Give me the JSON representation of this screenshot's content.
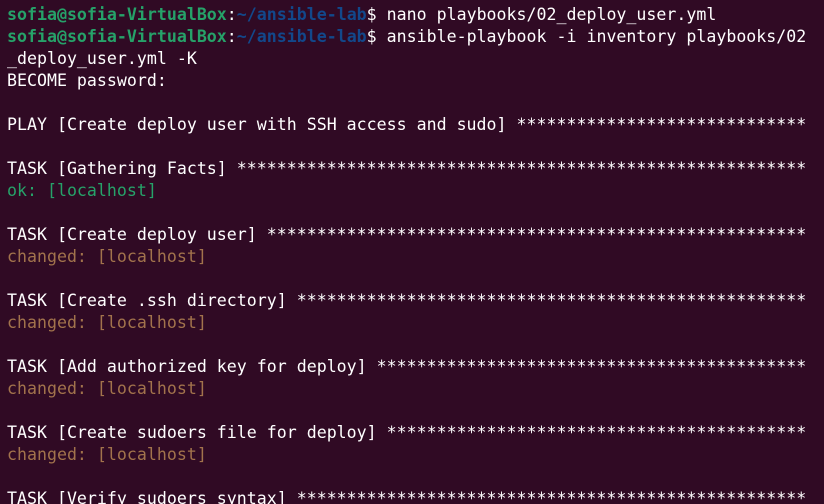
{
  "colors": {
    "background": "#300a24",
    "text": "#ffffff",
    "prompt_user": "#26a269",
    "prompt_path": "#12488b",
    "ok": "#26a269",
    "changed": "#a2734c"
  },
  "prompt": {
    "user_host": "sofia@sofia-VirtualBox",
    "colon": ":",
    "path": "~/ansible-lab",
    "dollar": "$ "
  },
  "commands": [
    "nano playbooks/02_deploy_user.yml",
    "ansible-playbook -i inventory playbooks/02"
  ],
  "command_wrap": "_deploy_user.yml -K",
  "become_prompt": "BECOME password:",
  "play_line": "PLAY [Create deploy user with SSH access and sudo] *****************************",
  "tasks": [
    {
      "header": "TASK [Gathering Facts] *********************************************************",
      "status": "ok: [localhost]"
    },
    {
      "header": "TASK [Create deploy user] ******************************************************",
      "status": "changed: [localhost]"
    },
    {
      "header": "TASK [Create .ssh directory] ***************************************************",
      "status": "changed: [localhost]"
    },
    {
      "header": "TASK [Add authorized key for deploy] *******************************************",
      "status": "changed: [localhost]"
    },
    {
      "header": "TASK [Create sudoers file for deploy] ******************************************",
      "status": "changed: [localhost]"
    },
    {
      "header": "TASK [Verify sudoers syntax] ***************************************************",
      "status": ""
    }
  ]
}
